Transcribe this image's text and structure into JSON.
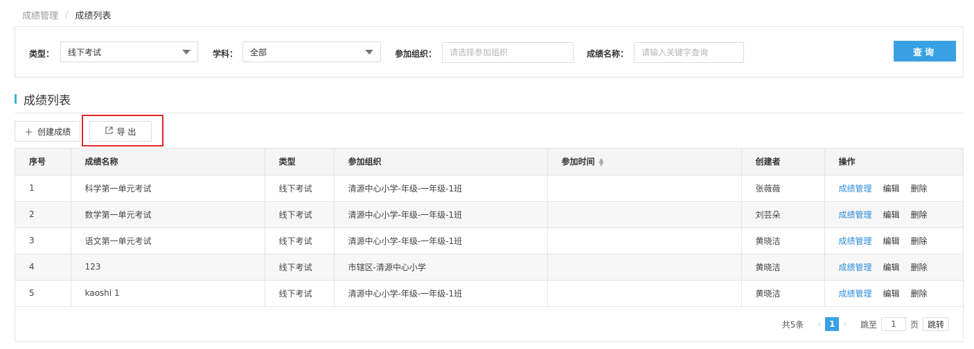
{
  "breadcrumb": {
    "parent": "成绩管理",
    "separator": "/",
    "current": "成绩列表"
  },
  "filters": {
    "type_label": "类型：",
    "type_value": "线下考试",
    "subject_label": "学科：",
    "subject_value": "全部",
    "org_label": "参加组织：",
    "org_placeholder": "请选择参加组织",
    "name_label": "成绩名称：",
    "name_placeholder": "请输入关键字查询",
    "query_button": "查询"
  },
  "section": {
    "title": "成绩列表"
  },
  "toolbar": {
    "create_label": "创建成绩",
    "export_label": "导 出"
  },
  "table": {
    "columns": [
      "序号",
      "成绩名称",
      "类型",
      "参加组织",
      "参加时间",
      "创建者",
      "操作"
    ],
    "actions": {
      "manage": "成绩管理",
      "edit": "编辑",
      "delete": "删除"
    },
    "rows": [
      {
        "index": "1",
        "name": "科学第一单元考试",
        "type": "线下考试",
        "org": "清源中心小学-年级-一年级-1班",
        "time": "",
        "creator": "张薇薇"
      },
      {
        "index": "2",
        "name": "数学第一单元考试",
        "type": "线下考试",
        "org": "清源中心小学-年级-一年级-1班",
        "time": "",
        "creator": "刘芸朵"
      },
      {
        "index": "3",
        "name": "语文第一单元考试",
        "type": "线下考试",
        "org": "清源中心小学-年级-一年级-1班",
        "time": "",
        "creator": "黄晓洁"
      },
      {
        "index": "4",
        "name": "123",
        "type": "线下考试",
        "org": "市辖区-清源中心小学",
        "time": "",
        "creator": "黄晓洁"
      },
      {
        "index": "5",
        "name": "kaoshi 1",
        "type": "线下考试",
        "org": "清源中心小学-年级-一年级-1班",
        "time": "",
        "creator": "黄晓洁"
      }
    ]
  },
  "pager": {
    "total": "共5条",
    "prev": "‹",
    "current_page": "1",
    "next": "›",
    "jump_label": "跳至",
    "jump_value": "1",
    "page_unit": "页",
    "jump_button": "跳转"
  },
  "colors": {
    "accent": "#3aa0e4",
    "link": "#2d8cd8",
    "highlight": "#e0282d",
    "title_bar": "#3bb4d6"
  }
}
